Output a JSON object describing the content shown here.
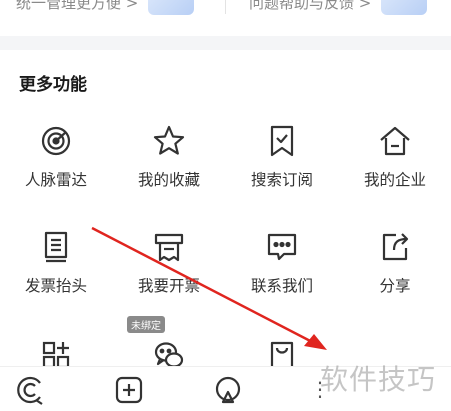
{
  "top_cards": {
    "left_text": "统一管理更方便 >",
    "right_text": "问题帮助与反馈 >"
  },
  "section": {
    "title": "更多功能"
  },
  "features": [
    {
      "label": "人脉雷达",
      "icon": "radar-target-icon"
    },
    {
      "label": "我的收藏",
      "icon": "star-icon"
    },
    {
      "label": "搜索订阅",
      "icon": "bookmark-subscribe-icon"
    },
    {
      "label": "我的企业",
      "icon": "house-icon"
    },
    {
      "label": "发票抬头",
      "icon": "invoice-icon"
    },
    {
      "label": "我要开票",
      "icon": "printer-icon"
    },
    {
      "label": "联系我们",
      "icon": "chat-bubble-icon"
    },
    {
      "label": "分享",
      "icon": "share-icon"
    },
    {
      "label": "",
      "icon": "apps-grid-icon"
    },
    {
      "label": "",
      "icon": "wechat-icon",
      "badge": "未绑定"
    },
    {
      "label": "",
      "icon": "bag-icon"
    }
  ],
  "tabbar": {
    "more_glyph": "⋮",
    "icons": [
      "brand-logo-icon",
      "add-square-icon",
      "location-icon"
    ]
  },
  "watermark": "软件技巧",
  "colors": {
    "icon_stroke": "#333333",
    "arrow": "#e0251f",
    "badge_bg": "#8a8a8a"
  }
}
